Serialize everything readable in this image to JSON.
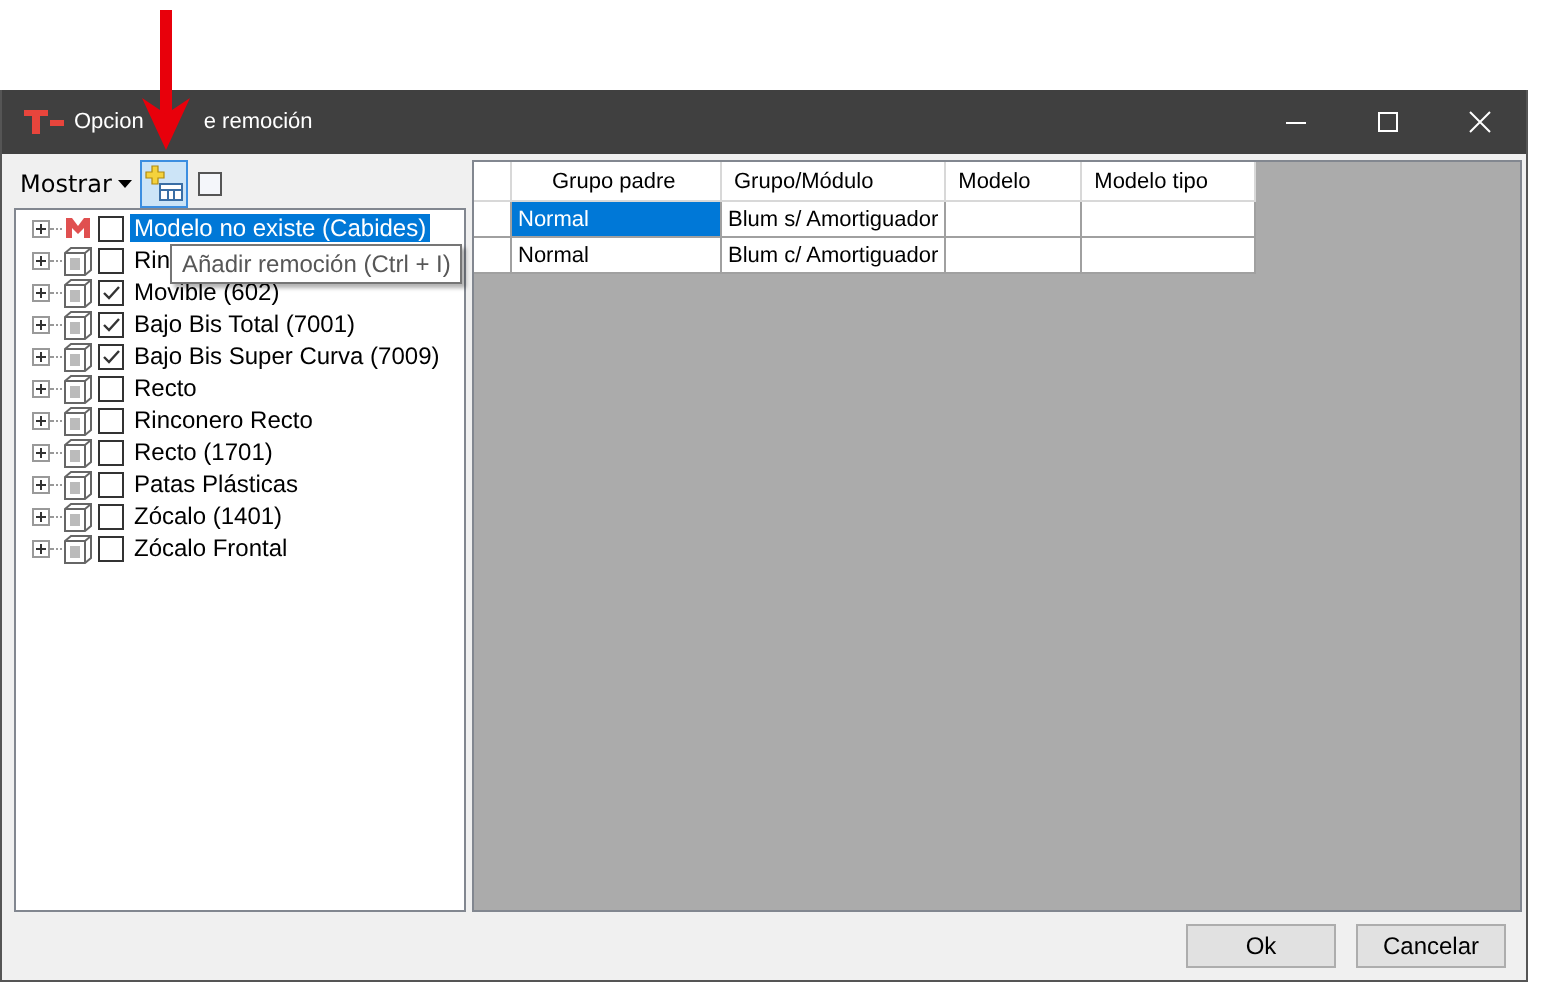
{
  "window": {
    "title_visible_left": "Opcion",
    "title_visible_right": "e remoción"
  },
  "toolbar": {
    "show_menu": "Mostrar",
    "tooltip": "Añadir remoción (Ctrl + I)"
  },
  "tree": [
    {
      "label": "Modelo no existe (Cabides)",
      "kind": "missing",
      "checked": false,
      "selected": true
    },
    {
      "label": "Rin",
      "kind": "module",
      "checked": false,
      "selected": false
    },
    {
      "label": "Movible (602)",
      "kind": "module",
      "checked": true,
      "selected": false
    },
    {
      "label": "Bajo Bis Total (7001)",
      "kind": "module",
      "checked": true,
      "selected": false
    },
    {
      "label": "Bajo Bis Super Curva (7009)",
      "kind": "module",
      "checked": true,
      "selected": false
    },
    {
      "label": "Recto",
      "kind": "module",
      "checked": false,
      "selected": false
    },
    {
      "label": "Rinconero Recto",
      "kind": "module",
      "checked": false,
      "selected": false
    },
    {
      "label": "Recto (1701)",
      "kind": "module",
      "checked": false,
      "selected": false
    },
    {
      "label": "Patas Plásticas",
      "kind": "module",
      "checked": false,
      "selected": false
    },
    {
      "label": "Zócalo (1401)",
      "kind": "module",
      "checked": false,
      "selected": false
    },
    {
      "label": "Zócalo Frontal",
      "kind": "module",
      "checked": false,
      "selected": false
    }
  ],
  "table": {
    "columns": [
      "Grupo padre",
      "Grupo/Módulo",
      "Modelo",
      "Modelo tipo"
    ],
    "rows": [
      {
        "cells": [
          "Normal",
          "Blum s/ Amortiguador",
          "",
          ""
        ],
        "selected": true
      },
      {
        "cells": [
          "Normal",
          "Blum c/ Amortiguador",
          "",
          ""
        ],
        "selected": false
      }
    ]
  },
  "buttons": [
    "Ok",
    "Cancelar"
  ]
}
